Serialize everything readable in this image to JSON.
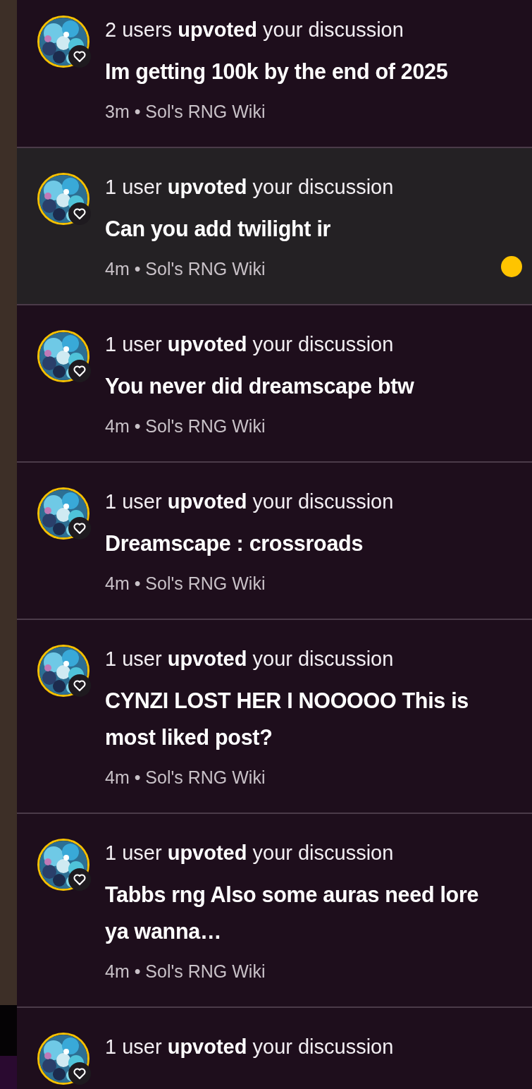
{
  "notifications": [
    {
      "summary": "2 users **upvoted** your discussion",
      "title": "Im getting 100k by the end of 2025",
      "meta": "3m • Sol's RNG Wiki",
      "unread": false
    },
    {
      "summary": "1 user **upvoted** your discussion",
      "title": "Can you add twilight ir",
      "meta": "4m • Sol's RNG Wiki",
      "unread": true
    },
    {
      "summary": "1 user **upvoted** your discussion",
      "title": "You never did dreamscape btw",
      "meta": "4m • Sol's RNG Wiki",
      "unread": false
    },
    {
      "summary": "1 user **upvoted** your discussion",
      "title": "Dreamscape : crossroads",
      "meta": "4m • Sol's RNG Wiki",
      "unread": false
    },
    {
      "summary": "1 user **upvoted** your discussion",
      "title": "CYNZI LOST HER I NOOOOO This is most liked post?",
      "meta": "4m • Sol's RNG Wiki",
      "unread": false
    },
    {
      "summary": "1 user **upvoted** your discussion",
      "title": "Tabbs rng Also some auras need lore ya wanna…",
      "meta": "4m • Sol's RNG Wiki",
      "unread": false
    },
    {
      "summary": "1 user **upvoted** your discussion",
      "unread": false
    }
  ]
}
